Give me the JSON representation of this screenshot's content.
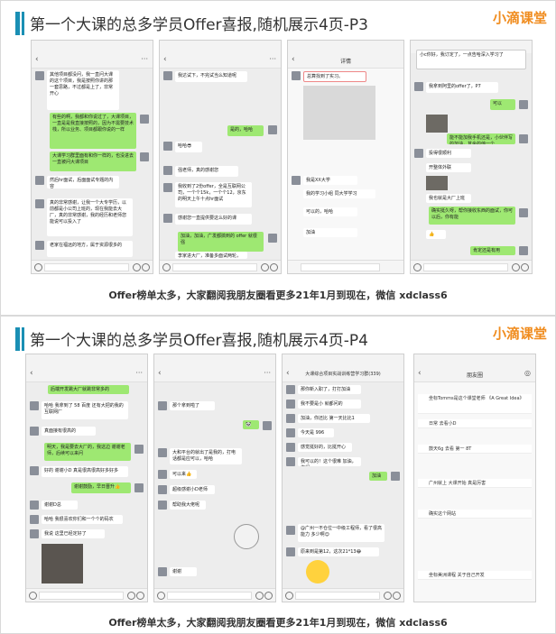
{
  "brand": {
    "name": "小滴课堂",
    "color": "#f08c1e"
  },
  "accent_color": "#1a8fb4",
  "slides": [
    {
      "title": "第一个大课的总多学员Offer喜报,随机展示4页-P3",
      "caption": "Offer榜单太多，大家翻阅我朋友圈看更多21年1月到现在，微信 xdclass6",
      "phones": [
        {
          "nav": "",
          "bubbles": [
            "其他项目都没问，我一直问大课的这个项目，我是按照你讲的那一套思路，不过都是上了，非常开心",
            "有些的啊，我都和你说过了，大课项目，一直是是我直接按照的，因为不需要技术栈，所以业务、项目都跟你说的一样",
            "大课学习群里面有和你一样的，也没进去一直被问大课项目",
            "然后hr面试，后面面试专题的内容",
            "真的非常感谢，让我一个大专学历，以前都是小公司上班的，现在我能去大厂，真的非常感谢，我的经历和老师您能说可以投入了",
            "老家在福远的地方，属于资源很多的"
          ]
        },
        {
          "nav": "",
          "bubbles": [
            "我达试下，不完试当么知道呢",
            "是的，哈哈",
            "哈哈😎",
            "强老师，真的感谢您",
            "我收到了2份offer，全是互联网公司，一个个15k，一个个12，京东的明天上午十点hr面试",
            "感谢您一直提供要这么好的课",
            "加油，加油，广发都搞到的 offer 就很强",
            "李家进大厂，准备多面试两轮，相信你的！",
            "😊"
          ]
        },
        {
          "nav": "详情",
          "bubbles": [
            "总算找到了实习。",
            "我是XX大学",
            "我的学习小组 同大学学习",
            "可以的，哈哈",
            "加油"
          ]
        },
        {
          "nav": "",
          "bubbles": [
            "新天地",
            "小c你好，我订定了，一点告哈深入学习了",
            "我拿到阿里的offer了，P7",
            "可以",
            "能不能加我手机还是，小伙伴写的加油，其余的他一个",
            "投得很顺利",
            "开整体外联",
            "我也就是大厂上班",
            "确实挺久呀，帮你接收东西的面试，你可以后，你有能",
            "👍",
            "肯定还是有用"
          ]
        }
      ]
    },
    {
      "title": "第一个大课的总多学员Offer喜报,随机展示4页-P4",
      "caption": "Offer榜单太多，大家翻阅我朋友圈看更多21年1月到现在，微信 xdclass6",
      "phones": [
        {
          "nav": "",
          "bubbles": [
            "后端开发跳大厂就跳非常多的",
            "哈哈 我拿到了 58 百度 还有大把的我的互联网厂",
            "真面接有很高的",
            "明天，我是要去大厂的，我这边 谢谢老师，后续可以来问",
            "好的 谢谢小D 真是很高很高好多好多",
            "谢谢鼓励，早日晋升👍",
            "谢谢D总",
            "哈哈 我很喜欢你们和一个个的码农",
            "我说 这里已经定好了"
          ]
        },
        {
          "nav": "",
          "bubbles": [
            "那个拿到啦了",
            "🐼",
            "大和平台的就出了是我的，打电话都是应可以，哈哈",
            "可以来👍",
            "超级感谢小D老师",
            "帮助我大佬呢",
            "谢谢"
          ]
        },
        {
          "nav": "大课综合项目实战训练营学习群(339)",
          "bubbles": [
            "那你新入职了，打打加油",
            "我不要是小 就都问的",
            "加油，你还比 第一天比比1",
            "今天是 996",
            "感觉挺好的，比挺开心",
            "我可以的！这个很难 加油，你们",
            "加油",
            "@广州一不仓位一中级工程师，看了很高能力 多少啊😉",
            "原来到是第12，这次21*13😂"
          ]
        },
        {
          "nav": "朋友圈",
          "bubbles": [
            "坐标Tomms是这个课堂老师 《A Great Idea》",
            "日常 去看小D",
            "鼓天6g 去看 第一 8T",
            "广州就上 大课开始 真是厉害",
            "确实这个网站",
            "坐标美洲课程 关于自己开发"
          ]
        }
      ]
    }
  ]
}
